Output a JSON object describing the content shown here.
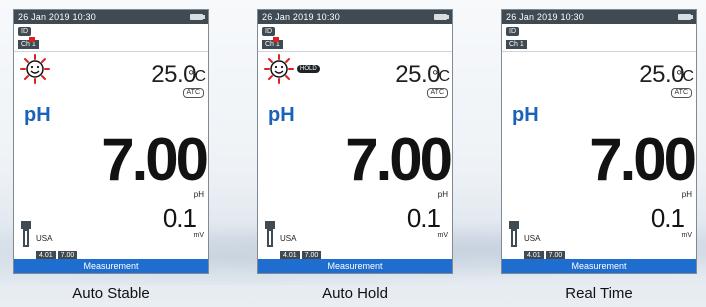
{
  "colors": {
    "accent_blue": "#1f6ecf",
    "ph_label_blue": "#1c62b8",
    "dark_bar": "#3f4a52",
    "stable_red": "#e02020"
  },
  "screens": [
    {
      "datetime": "26 Jan 2019  10:30",
      "id_label": "ID",
      "channel_label": "Ch 1",
      "stability_icon": "smiley-icon",
      "temperature": "25.0",
      "temperature_unit": "°C",
      "atc_label": "ATC",
      "mode_label": "pH",
      "reading": "7.00",
      "reading_unit": "pH",
      "mv_value": "0.1",
      "mv_unit": "mV",
      "buffer_group": "USA",
      "buffers": [
        "4.01",
        "7.00"
      ],
      "status_bar": "Measurement",
      "caption": "Auto Stable"
    },
    {
      "datetime": "26 Jan 2019  10:30",
      "id_label": "ID",
      "channel_label": "Ch 1",
      "stability_icon": "smiley-icon",
      "hold_label": "HOLD",
      "temperature": "25.0",
      "temperature_unit": "°C",
      "atc_label": "ATC",
      "mode_label": "pH",
      "reading": "7.00",
      "reading_unit": "pH",
      "mv_value": "0.1",
      "mv_unit": "mV",
      "buffer_group": "USA",
      "buffers": [
        "4.01",
        "7.00"
      ],
      "status_bar": "Measurement",
      "caption": "Auto Hold"
    },
    {
      "datetime": "26 Jan 2019  10:30",
      "id_label": "ID",
      "channel_label": "Ch 1",
      "temperature": "25.0",
      "temperature_unit": "°C",
      "atc_label": "ATC",
      "mode_label": "pH",
      "reading": "7.00",
      "reading_unit": "pH",
      "mv_value": "0.1",
      "mv_unit": "mV",
      "buffer_group": "USA",
      "buffers": [
        "4.01",
        "7.00"
      ],
      "status_bar": "Measurement",
      "caption": "Real Time"
    }
  ]
}
